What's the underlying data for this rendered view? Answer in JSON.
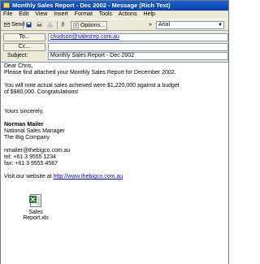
{
  "window": {
    "title": "Monthly Sales Report - Dec 2002 - Message (Rich Text)"
  },
  "menu": [
    "File",
    "Edit",
    "View",
    "Insert",
    "Format",
    "Tools",
    "Actions",
    "Help"
  ],
  "toolbar": {
    "send_label": "Send",
    "options_label": "Options...",
    "font_value": "Arial"
  },
  "header": {
    "to_label": "To...",
    "to_value": "chudson@salesrep.com.au",
    "cc_label": "Cc...",
    "cc_value": "",
    "subject_label": "Subject:",
    "subject_value": "Monthly Sales Report - Dec 2002"
  },
  "body": {
    "greeting": "Dear Chris,",
    "line1": "Please find attached your Monthly Sales Report for December 2002.",
    "para2a": "You will note actual sales acheived were $1,220,000 against a budget",
    "para2b": "of $980,000.  Congratulations!",
    "closing": "Yours sincerely,",
    "sig_name": "Norman Mailer",
    "sig_title": "National Sales Manager",
    "sig_company": "The Big Company",
    "email": "nmailer@thebigco.com.au",
    "tel": "tel:   +61 3 9555 1234",
    "fax": "fax:  +61 3 9555 4567",
    "web_prefix": "Visit our website at ",
    "web_link": "http://www.thebigco.com.au"
  },
  "attachment": {
    "name": "Sales Report.xls",
    "icon": "excel-file-icon"
  }
}
